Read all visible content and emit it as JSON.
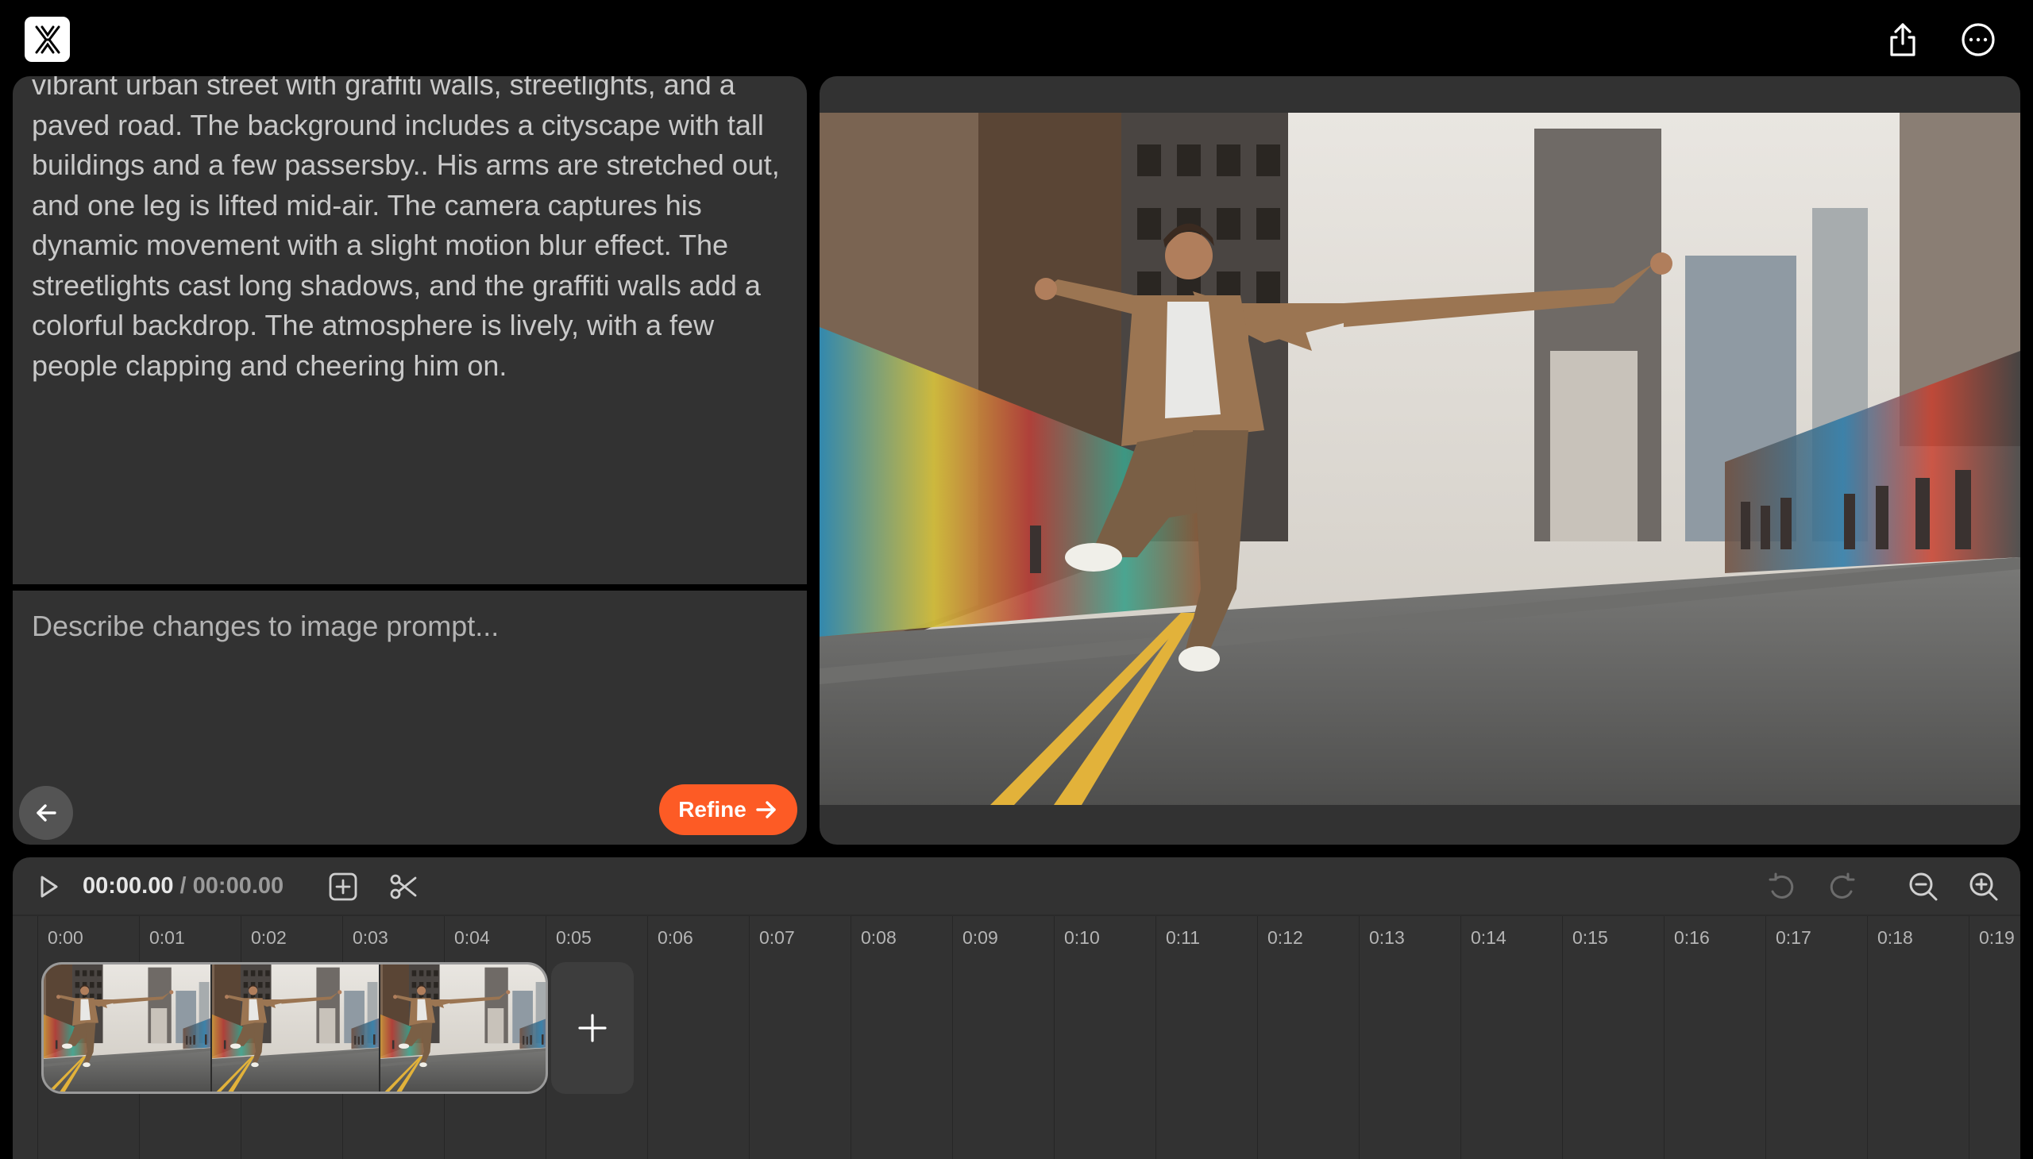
{
  "app": {
    "logo_icon": "app-logo-icon",
    "accent_color": "#fd5b25"
  },
  "header": {
    "share_icon": "share-icon",
    "more_icon": "more-options-icon"
  },
  "prompt": {
    "text": "vibrant urban street with graffiti walls, streetlights, and a paved road. The background includes a cityscape with tall buildings and a few passersby.. His arms are stretched out, and one leg is lifted mid-air. The camera captures his dynamic movement with a slight motion blur effect. The streetlights cast long shadows, and the graffiti walls add a colorful backdrop. The atmosphere is lively, with a few people clapping and cheering him on."
  },
  "refine": {
    "placeholder": "Describe changes to image prompt...",
    "value": "",
    "button_label": "Refine"
  },
  "timeline": {
    "current_time": "00:00.00",
    "separator": " / ",
    "duration": "00:00.00",
    "ticks": [
      "0:00",
      "0:01",
      "0:02",
      "0:03",
      "0:04",
      "0:05",
      "0:06",
      "0:07",
      "0:08",
      "0:09",
      "0:10",
      "0:11",
      "0:12",
      "0:13",
      "0:14",
      "0:15",
      "0:16",
      "0:17",
      "0:18",
      "0:19"
    ],
    "clip_thumbnails": 3,
    "add_clip_icon": "plus-icon"
  }
}
